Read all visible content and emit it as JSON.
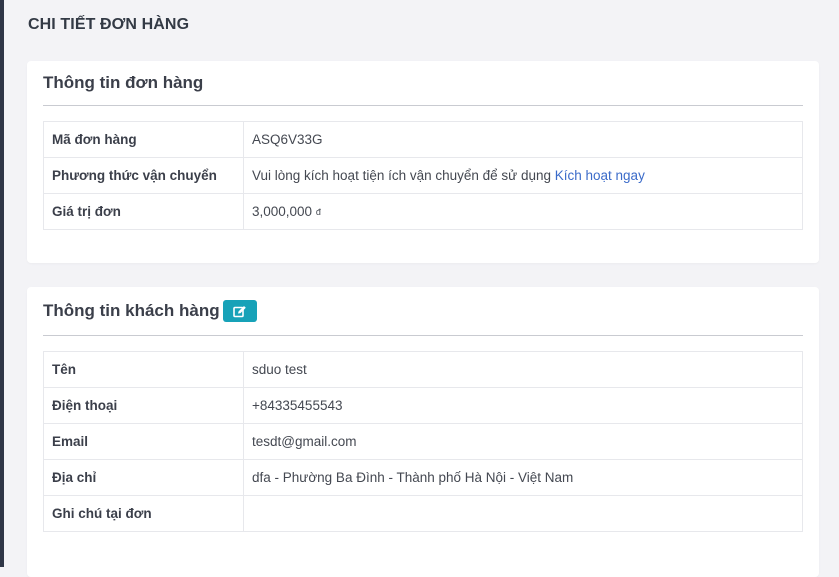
{
  "page": {
    "title": "CHI TIẾT ĐƠN HÀNG"
  },
  "order_info": {
    "title": "Thông tin đơn hàng",
    "rows": [
      {
        "label": "Mã đơn hàng",
        "value": "ASQ6V33G"
      },
      {
        "label": "Phương thức vận chuyển",
        "value": "Vui lòng kích hoạt tiện ích vận chuyển để sử dụng",
        "link": "Kích hoạt ngay"
      },
      {
        "label": "Giá trị đơn",
        "value": "3,000,000",
        "currency": "đ"
      }
    ]
  },
  "customer_info": {
    "title": "Thông tin khách hàng",
    "edit_icon": "edit-icon",
    "accent_color": "#17a2b8",
    "rows": [
      {
        "label": "Tên",
        "value": "sduo test"
      },
      {
        "label": "Điện thoại",
        "value": "+84335455543"
      },
      {
        "label": "Email",
        "value": "tesdt@gmail.com"
      },
      {
        "label": "Địa chỉ",
        "value": "dfa - Phường Ba Đình - Thành phố Hà Nội - Việt Nam"
      },
      {
        "label": "Ghi chú tại đơn",
        "value": ""
      }
    ]
  }
}
